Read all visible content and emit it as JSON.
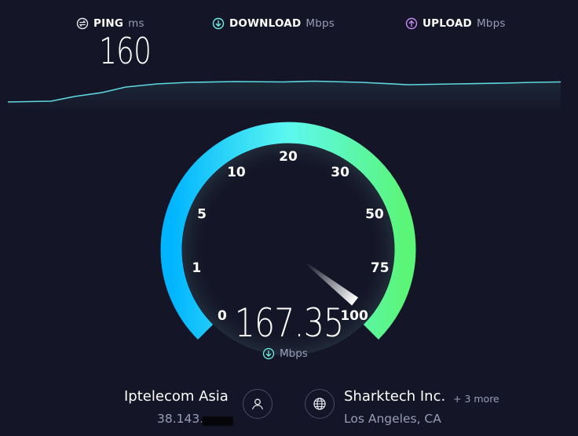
{
  "metrics": {
    "ping": {
      "label": "PING",
      "unit": "ms",
      "value": "160",
      "icon": "ping-icon",
      "color": "#e8e8f0"
    },
    "download": {
      "label": "DOWNLOAD",
      "unit": "Mbps",
      "icon": "download-arrow-icon",
      "color": "#6ef0e8"
    },
    "upload": {
      "label": "UPLOAD",
      "unit": "Mbps",
      "icon": "upload-arrow-icon",
      "color": "#c58cf5"
    }
  },
  "gauge": {
    "tick_labels": [
      "0",
      "1",
      "5",
      "10",
      "20",
      "30",
      "50",
      "75",
      "100"
    ],
    "speed_value": "167.35",
    "speed_unit": "Mbps",
    "gradient_start": "#00b4ff",
    "gradient_mid": "#5cf8f0",
    "gradient_end": "#5bf578"
  },
  "isp": {
    "name": "Iptelecom Asia",
    "ip": "38.143."
  },
  "server": {
    "name": "Sharktech Inc.",
    "more": "+ 3 more",
    "location": "Los Angeles, CA"
  },
  "colors": {
    "background": "#141526",
    "graph_line": "#5fd8e0"
  }
}
